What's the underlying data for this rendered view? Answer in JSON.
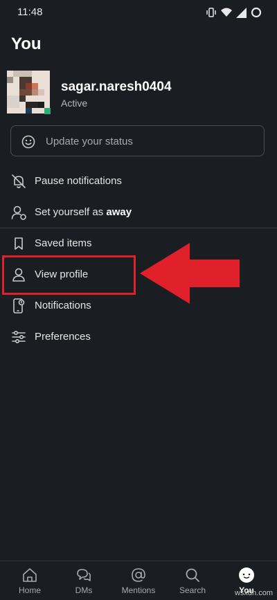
{
  "status_bar": {
    "time": "11:48"
  },
  "page": {
    "title": "You"
  },
  "profile": {
    "username": "sagar.naresh0404",
    "presence": "Active"
  },
  "status_input": {
    "placeholder": "Update your status",
    "icon": "smiley-icon"
  },
  "menu": {
    "pause_notifications": {
      "label": "Pause notifications",
      "icon": "bell-off-icon"
    },
    "set_away": {
      "prefix": "Set yourself as ",
      "emphasis": "away",
      "icon": "person-away-icon"
    },
    "saved_items": {
      "label": "Saved items",
      "icon": "bookmark-icon"
    },
    "view_profile": {
      "label": "View profile",
      "icon": "person-icon"
    },
    "notifications": {
      "label": "Notifications",
      "icon": "phone-bell-icon"
    },
    "preferences": {
      "label": "Preferences",
      "icon": "sliders-icon"
    }
  },
  "annotation": {
    "color": "#e0202b"
  },
  "bottom_nav": {
    "home": "Home",
    "dms": "DMs",
    "mentions": "Mentions",
    "search": "Search",
    "you": "You",
    "active": "you"
  },
  "watermark": "wsxdn.com",
  "colors": {
    "background": "#1a1d21",
    "presence": "#2bac76",
    "highlight": "#e0202b"
  }
}
